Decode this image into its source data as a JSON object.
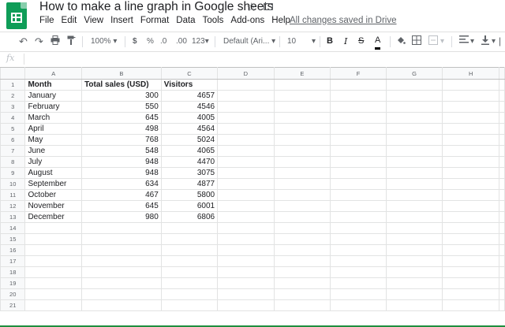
{
  "doc": {
    "title": "How to make a line graph in Google sheets",
    "saved_status": "All changes saved in Drive"
  },
  "menu": [
    "File",
    "Edit",
    "View",
    "Insert",
    "Format",
    "Data",
    "Tools",
    "Add-ons",
    "Help"
  ],
  "toolbar": {
    "zoom": "100%",
    "currency": "$",
    "percent": "%",
    "decrease_decimal": ".0",
    "increase_decimal": ".00",
    "more_formats": "123",
    "font": "Default (Ari...",
    "font_size": "10",
    "bold": "B",
    "italic": "I",
    "strikethrough": "S",
    "text_color": "A"
  },
  "formula_bar": {
    "fx": "fx",
    "value": ""
  },
  "columns": [
    "A",
    "B",
    "C",
    "D",
    "E",
    "F",
    "G",
    "H"
  ],
  "rows": [
    [
      "Month",
      "Total sales (USD)",
      "Visitors"
    ],
    [
      "January",
      "300",
      "4657"
    ],
    [
      "February",
      "550",
      "4546"
    ],
    [
      "March",
      "645",
      "4005"
    ],
    [
      "April",
      "498",
      "4564"
    ],
    [
      "May",
      "768",
      "5024"
    ],
    [
      "June",
      "548",
      "4065"
    ],
    [
      "July",
      "948",
      "4470"
    ],
    [
      "August",
      "948",
      "3075"
    ],
    [
      "September",
      "634",
      "4877"
    ],
    [
      "October",
      "467",
      "5800"
    ],
    [
      "November",
      "645",
      "6001"
    ],
    [
      "December",
      "980",
      "6806"
    ]
  ],
  "row_count": 21,
  "colors": {
    "brand_green": "#0f9d58",
    "grid_line": "#e2e3e3",
    "header_bg": "#f8f9fa"
  }
}
